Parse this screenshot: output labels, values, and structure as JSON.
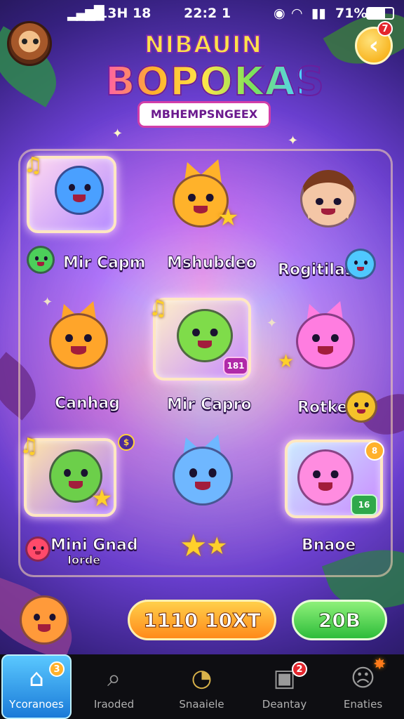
{
  "status_bar": {
    "left": "13H 18",
    "time": "22:2 1",
    "battery": "71%"
  },
  "header": {
    "title_line1": "NIBAUIN",
    "title_line2": "BOPOKAS",
    "subtitle": "MBHEMPSNGEEX",
    "back_badge": "7"
  },
  "characters": [
    {
      "label": "Mir Capm",
      "color": "#4aa0ff"
    },
    {
      "label": "Mshubdeo",
      "color": "#ffb22a"
    },
    {
      "label": "Rogitilas",
      "color": "#f4c6a6"
    },
    {
      "label": "Canhag",
      "color": "#ffa52a"
    },
    {
      "label": "Mir Capro",
      "color": "#7fdc4a",
      "tag": "181"
    },
    {
      "label": "Rotke",
      "color": "#ff7de0"
    },
    {
      "label": "Mini Gnad",
      "sublabel": "Iorde",
      "color": "#6ccf4a"
    },
    {
      "label": "",
      "color": "#6fb7ff"
    },
    {
      "label": "Bnaoe",
      "color": "#ff8ce0",
      "tag": "16",
      "coin": "8"
    }
  ],
  "buttons": {
    "primary": "1110 10XT",
    "secondary": "20B"
  },
  "nav": [
    {
      "label": "Ycoranoes",
      "icon": "home-icon",
      "badge": "3"
    },
    {
      "label": "Iraoded",
      "icon": "search-icon"
    },
    {
      "label": "Snaaiele",
      "icon": "brush-icon"
    },
    {
      "label": "Deantay",
      "icon": "frame-icon",
      "badge": "2"
    },
    {
      "label": "Enaties",
      "icon": "person-icon"
    }
  ],
  "colors": {
    "accent": "#ffb12b",
    "green_button": "#4ed84a",
    "nav_active": "#2a8ee6"
  }
}
